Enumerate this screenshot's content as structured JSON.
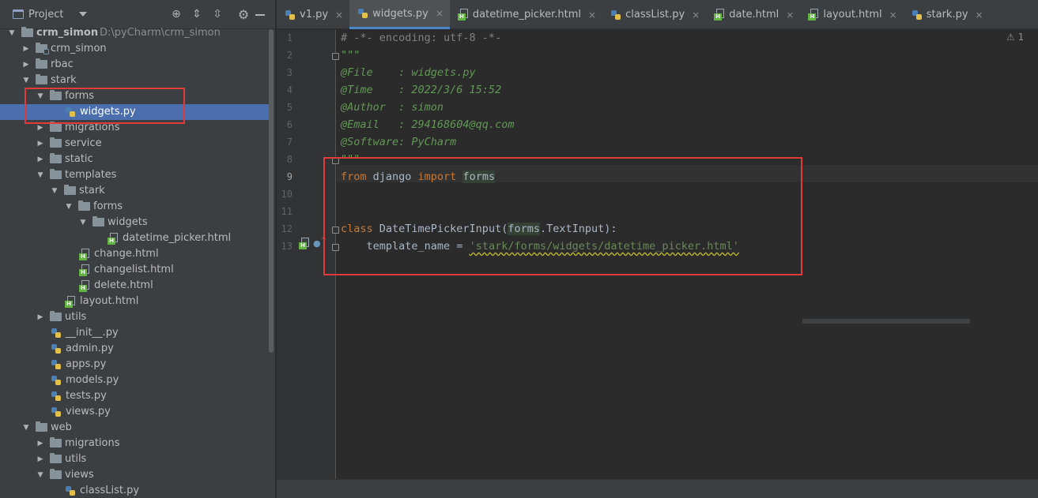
{
  "project_panel": {
    "title": "Project",
    "toolbar_icons": [
      "locate-icon",
      "expand-all-icon",
      "collapse-all-icon",
      "gear-icon",
      "hide-icon"
    ]
  },
  "tree": [
    {
      "label": "crm_simon",
      "hint": "D:\\pyCharm\\crm_simon",
      "type": "root",
      "expanded": true
    },
    {
      "label": "crm_simon",
      "type": "folder",
      "expanded": false
    },
    {
      "label": "rbac",
      "type": "folder",
      "expanded": false
    },
    {
      "label": "stark",
      "type": "folder",
      "expanded": true
    },
    {
      "label": "forms",
      "type": "folder",
      "expanded": true
    },
    {
      "label": "widgets.py",
      "type": "py",
      "selected": true
    },
    {
      "label": "migrations",
      "type": "folder",
      "expanded": false
    },
    {
      "label": "service",
      "type": "folder",
      "expanded": false
    },
    {
      "label": "static",
      "type": "folder",
      "expanded": false
    },
    {
      "label": "templates",
      "type": "folder",
      "expanded": true
    },
    {
      "label": "stark",
      "type": "folder",
      "expanded": true
    },
    {
      "label": "forms",
      "type": "folder",
      "expanded": true
    },
    {
      "label": "widgets",
      "type": "folder",
      "expanded": true
    },
    {
      "label": "datetime_picker.html",
      "type": "html"
    },
    {
      "label": "change.html",
      "type": "html"
    },
    {
      "label": "changelist.html",
      "type": "html"
    },
    {
      "label": "delete.html",
      "type": "html"
    },
    {
      "label": "layout.html",
      "type": "html"
    },
    {
      "label": "utils",
      "type": "folder",
      "expanded": false
    },
    {
      "label": "__init__.py",
      "type": "py"
    },
    {
      "label": "admin.py",
      "type": "py"
    },
    {
      "label": "apps.py",
      "type": "py"
    },
    {
      "label": "models.py",
      "type": "py"
    },
    {
      "label": "tests.py",
      "type": "py"
    },
    {
      "label": "views.py",
      "type": "py"
    },
    {
      "label": "web",
      "type": "folder",
      "expanded": true
    },
    {
      "label": "migrations",
      "type": "folder",
      "expanded": false
    },
    {
      "label": "utils",
      "type": "folder",
      "expanded": false
    },
    {
      "label": "views",
      "type": "folder",
      "expanded": true
    },
    {
      "label": "classList.py",
      "type": "py"
    }
  ],
  "tabs": [
    {
      "label": "v1.py",
      "type": "py",
      "active": false
    },
    {
      "label": "widgets.py",
      "type": "py",
      "active": true
    },
    {
      "label": "datetime_picker.html",
      "type": "html",
      "active": false
    },
    {
      "label": "classList.py",
      "type": "py",
      "active": false
    },
    {
      "label": "date.html",
      "type": "html",
      "active": false
    },
    {
      "label": "layout.html",
      "type": "html",
      "active": false
    },
    {
      "label": "stark.py",
      "type": "py",
      "active": false
    }
  ],
  "editor": {
    "warning_count": "1",
    "lines": [
      {
        "n": "1",
        "parts": [
          {
            "t": "# -*- encoding: utf-8 -*-",
            "c": "comment"
          }
        ]
      },
      {
        "n": "2",
        "parts": [
          {
            "t": "\"\"\"",
            "c": "doc"
          }
        ]
      },
      {
        "n": "3",
        "parts": [
          {
            "t": "@File    : widgets.py",
            "c": "doc"
          }
        ]
      },
      {
        "n": "4",
        "parts": [
          {
            "t": "@Time    : 2022/3/6 15:52",
            "c": "doc"
          }
        ]
      },
      {
        "n": "5",
        "parts": [
          {
            "t": "@Author  : simon",
            "c": "doc"
          }
        ]
      },
      {
        "n": "6",
        "parts": [
          {
            "t": "@Email   : 294168604@qq.com",
            "c": "doc"
          }
        ]
      },
      {
        "n": "7",
        "parts": [
          {
            "t": "@Software: PyCharm",
            "c": "doc"
          }
        ]
      },
      {
        "n": "8",
        "parts": [
          {
            "t": "\"\"\"",
            "c": "doc"
          }
        ]
      },
      {
        "n": "9",
        "parts": [
          {
            "t": "from",
            "c": "kw"
          },
          {
            "t": " django ",
            "c": "plain"
          },
          {
            "t": "import",
            "c": "kw"
          },
          {
            "t": " ",
            "c": "plain"
          },
          {
            "t": "forms",
            "c": "hl"
          }
        ]
      },
      {
        "n": "10",
        "parts": []
      },
      {
        "n": "11",
        "parts": []
      },
      {
        "n": "12",
        "parts": [
          {
            "t": "class",
            "c": "kw"
          },
          {
            "t": " DateTimePickerInput(",
            "c": "plain"
          },
          {
            "t": "forms",
            "c": "hl"
          },
          {
            "t": ".TextInput):",
            "c": "plain"
          }
        ]
      },
      {
        "n": "13",
        "parts": [
          {
            "t": "    template_name = ",
            "c": "plain"
          },
          {
            "t": "'stark/forms/widgets/datetime_picker.html'",
            "c": "str"
          }
        ]
      }
    ]
  },
  "colors": {
    "accent": "#4a88c7",
    "highlight_box": "#e03a3a",
    "keyword": "#cc7832",
    "docstring": "#629755",
    "string": "#6a8759"
  }
}
